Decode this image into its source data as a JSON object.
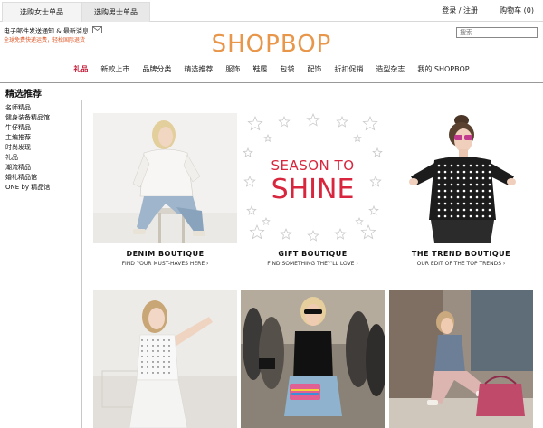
{
  "topbar": {
    "tab_women": "选购女士单品",
    "tab_men": "选购男士单品",
    "account": "登录 / 注册",
    "cart": "购物车 (0)"
  },
  "header": {
    "email_promo": "电子邮件发送通知 & 最新消息",
    "promo_sub": "全球免费快递运费，轻松国际退货",
    "logo": "SHOPBOP",
    "search_placeholder": "搜索"
  },
  "nav": {
    "items": [
      "礼品",
      "新款上市",
      "品牌分类",
      "精选推荐",
      "服饰",
      "鞋履",
      "包袋",
      "配饰",
      "折扣促销",
      "造型杂志",
      "我的 SHOPBOP"
    ],
    "active_index": 0
  },
  "page_title": "精选推荐",
  "sidebar": {
    "items": [
      "名师精品",
      "健身装备精品馆",
      "牛仔精品",
      "主编推荐",
      "时尚发现",
      "礼品",
      "潮流精品",
      "婚礼精品馆",
      "ONE by 精品馆"
    ]
  },
  "tiles": [
    {
      "title": "DENIM BOUTIQUE",
      "subtitle": "FIND YOUR MUST-HAVES HERE ›"
    },
    {
      "title": "GIFT BOUTIQUE",
      "subtitle": "FIND SOMETHING THEY'LL LOVE ›"
    },
    {
      "title": "THE TREND BOUTIQUE",
      "subtitle": "OUR EDIT OF THE TOP TRENDS ›"
    }
  ],
  "promo_graphic": {
    "line1": "SEASON TO",
    "line2": "SHINE"
  },
  "colors": {
    "accent_red": "#c41e3a",
    "logo_orange": "#e8964a",
    "promo_red": "#d7263d"
  }
}
